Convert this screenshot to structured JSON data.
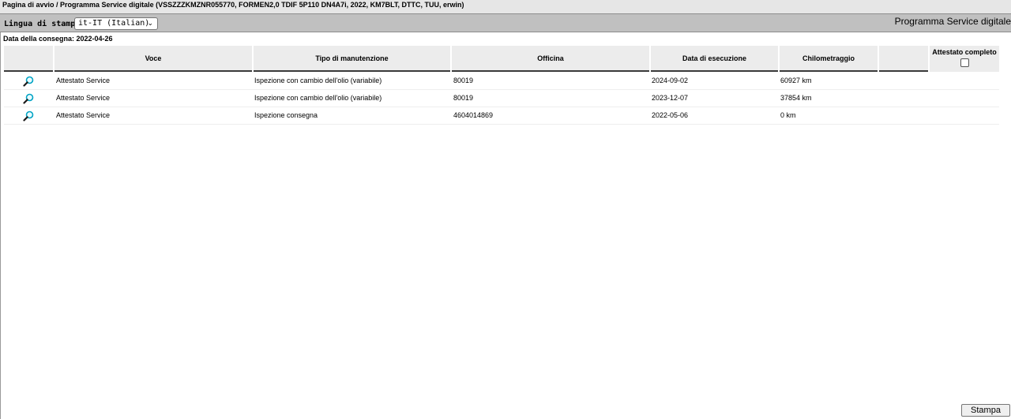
{
  "breadcrumb": "Pagina di avvio / Programma Service digitale (VSSZZZKMZNR055770, FORMEN2,0 TDIF 5P110 DN4A7i, 2022, KM7BLT, DTTC, TUU, erwin)",
  "toolbar": {
    "language_label": "Lingua di stampa:",
    "language_value": "it-IT (Italian)",
    "app_title": "Programma Service digitale"
  },
  "delivery_date": "Data della consegna: 2022-04-26",
  "table": {
    "headers": {
      "voce": "Voce",
      "tipo": "Tipo di manutenzione",
      "officina": "Officina",
      "data": "Data di esecuzione",
      "km": "Chilometraggio",
      "extra": "",
      "attestato": "Attestato completo"
    },
    "rows": [
      {
        "voce": "Attestato Service",
        "tipo": "Ispezione con cambio dell'olio (variabile)",
        "officina": "80019",
        "data": "2024-09-02",
        "km": "60927 km"
      },
      {
        "voce": "Attestato Service",
        "tipo": "Ispezione con cambio dell'olio (variabile)",
        "officina": "80019",
        "data": "2023-12-07",
        "km": "37854 km"
      },
      {
        "voce": "Attestato Service",
        "tipo": "Ispezione consegna",
        "officina": "4604014869",
        "data": "2022-05-06",
        "km": "0 km"
      }
    ]
  },
  "buttons": {
    "print": "Stampa"
  },
  "colors": {
    "lens": "#00a3c4",
    "header_bg": "#ececec",
    "toolbar_bg": "#c0c0c0"
  },
  "icons": {
    "view": "magnifier-icon",
    "dropdown": "chevron-down-icon"
  }
}
